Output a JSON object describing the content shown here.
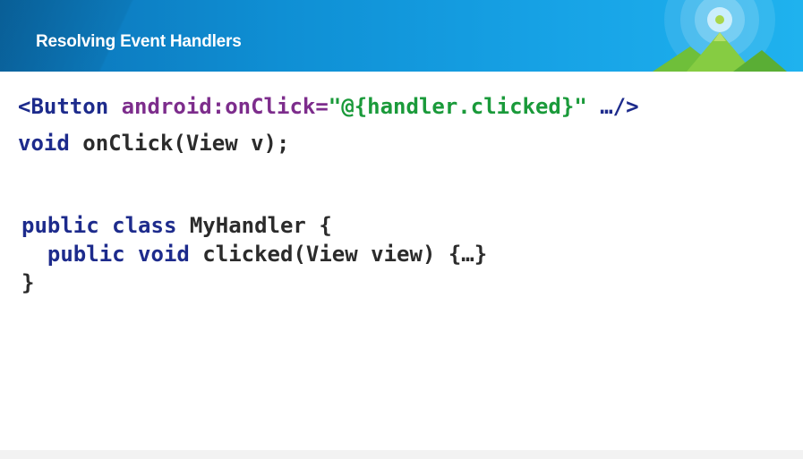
{
  "header": {
    "title": "Resolving Event Handlers"
  },
  "code": {
    "line1": {
      "open": "<Button",
      "attr": " android:onClick=",
      "value": "\"@{handler.clicked}\"",
      "close": " …/>"
    },
    "line2": {
      "kw": "void",
      "rest": " onClick(View v);"
    },
    "line3": {
      "kw": "public class",
      "rest": " MyHandler {"
    },
    "line4": {
      "indent": "  ",
      "kw": "public void",
      "rest": " clicked(View view) {…}"
    },
    "line5": {
      "rest": "}"
    }
  },
  "colors": {
    "header_start": "#0b73b7",
    "header_end": "#1fb2ee",
    "tag": "#1d2b8c",
    "attr": "#7d2d8c",
    "string": "#1a9a3a",
    "text": "#2b2b2b"
  }
}
